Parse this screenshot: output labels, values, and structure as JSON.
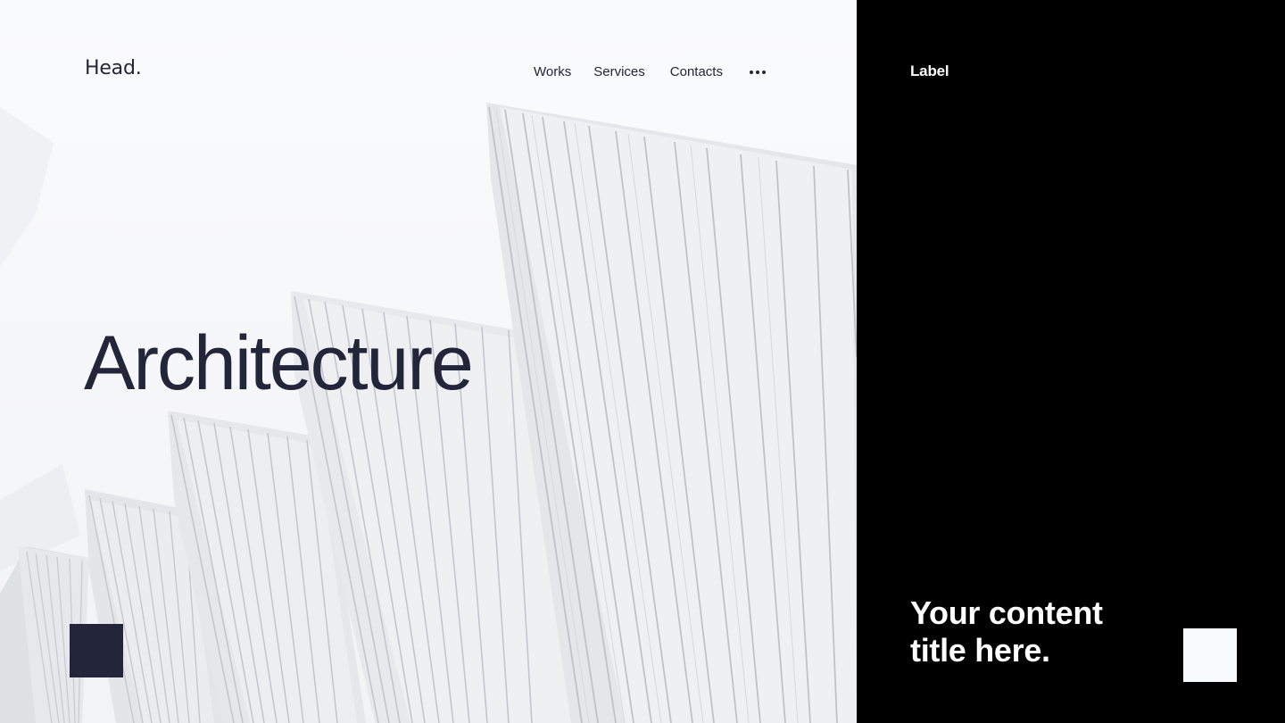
{
  "header": {
    "logo": "Head.",
    "nav": [
      "Works",
      "Services",
      "Contacts"
    ],
    "more_icon": "more-horizontal-icon"
  },
  "hero": {
    "title": "Architecture",
    "image": "white-fan-architecture-photo"
  },
  "panel": {
    "label": "Label",
    "title": "Your content title here."
  },
  "colors": {
    "hero_background": "#f9fafc",
    "panel_background": "#000000",
    "text_dark": "#23253a",
    "text_light": "#ffffff",
    "square_dark": "#23253a",
    "square_light": "#f9fafc"
  }
}
